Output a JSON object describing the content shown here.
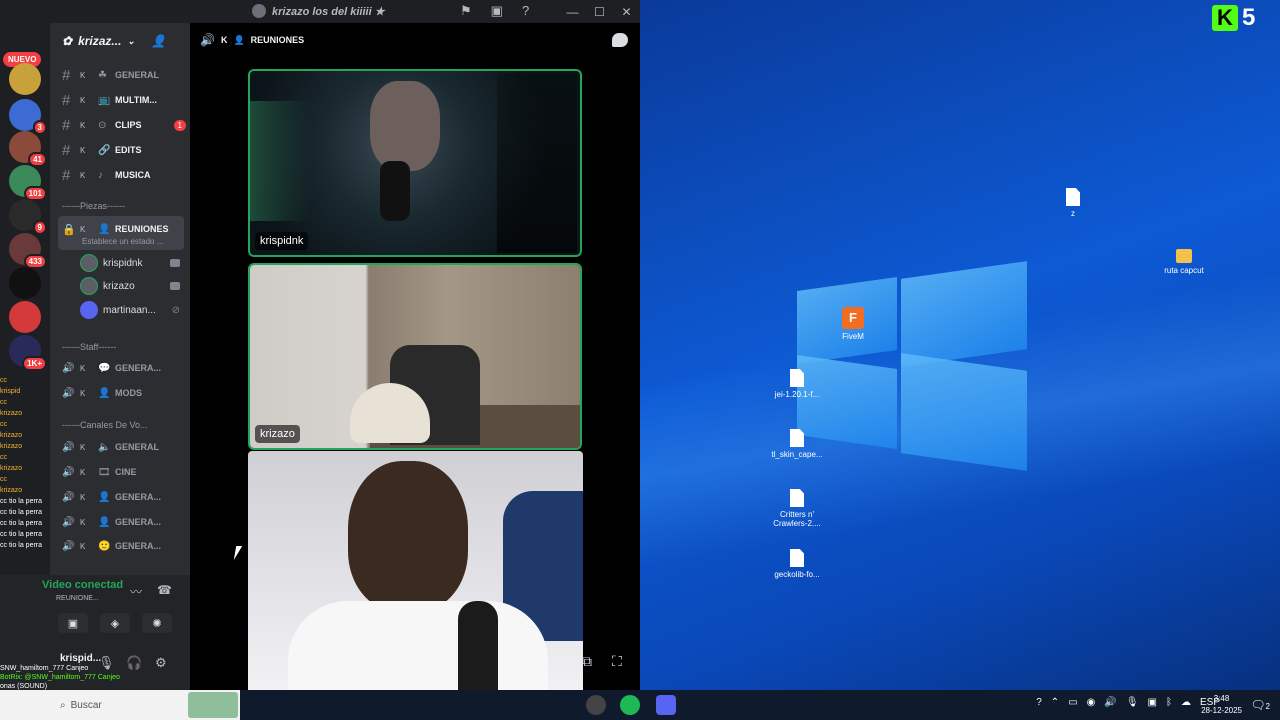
{
  "window": {
    "title": "krizazo los del kiiiii ★"
  },
  "servers": {
    "new_badge": "NUEVO",
    "items": [
      {
        "badge": ""
      },
      {
        "badge": "3"
      },
      {
        "badge": "41"
      },
      {
        "badge": "101"
      },
      {
        "badge": "9"
      },
      {
        "badge": "433"
      },
      {
        "badge": ""
      },
      {
        "badge": ""
      },
      {
        "badge": "1K+"
      }
    ]
  },
  "server": {
    "name": "krizaz..."
  },
  "text_channels": [
    {
      "k": "K",
      "name": "GENERAL",
      "emoji": "☘",
      "badge": ""
    },
    {
      "k": "K",
      "name": "MULTIM...",
      "emoji": "📺",
      "badge": ""
    },
    {
      "k": "K",
      "name": "CLIPS",
      "emoji": "⊙",
      "badge": "1"
    },
    {
      "k": "K",
      "name": "EDITS",
      "emoji": "🔗",
      "badge": ""
    },
    {
      "k": "K",
      "name": "MUSICA",
      "emoji": "♪",
      "badge": ""
    }
  ],
  "categories": {
    "piezas": "------Piezas------",
    "staff": "------Staff------",
    "canales_voz": "------Canales De Vo..."
  },
  "active_channel": {
    "k": "K",
    "name": "REUNIONES",
    "status": "Establece un estado ..."
  },
  "voice_users": [
    {
      "name": "krispidnk"
    },
    {
      "name": "krizazo"
    },
    {
      "name": "martinaan..."
    }
  ],
  "staff_channels": [
    {
      "k": "K",
      "name": "GENERA..."
    },
    {
      "k": "K",
      "name": "MODS"
    }
  ],
  "voice_channels": [
    {
      "k": "K",
      "name": "GENERAL"
    },
    {
      "k": "K",
      "name": "CINE"
    },
    {
      "k": "K",
      "name": "GENERA..."
    },
    {
      "k": "K",
      "name": "GENERA..."
    },
    {
      "k": "K",
      "name": "GENERA..."
    }
  ],
  "voice_panel": {
    "status": "Video conectad",
    "channel": "REUNIONE...",
    "user": "krispid..."
  },
  "stage": {
    "k": "K",
    "channel": "REUNIONES",
    "tiles": [
      {
        "name": "krispidnk"
      },
      {
        "name": "krizazo"
      }
    ]
  },
  "chat_overlay": {
    "lines": [
      "cc",
      "krispid",
      "cc",
      "krizazo",
      "cc",
      "krizazo",
      "krizazo",
      "cc",
      "krizazo",
      "cc",
      "krizazo"
    ],
    "lines2": [
      "cc tio la perra",
      "cc tio la perra",
      "cc tio la perra",
      "cc tio la perra",
      "cc tio la perra"
    ],
    "bottom1": "SNW_hamiltom_777 Canjeo",
    "bottom2": "BotRix: @SNW_hamiltom_777 Canjeo",
    "bottom3": "onas (SOUND)"
  },
  "desktop": {
    "icons": [
      {
        "label": "z"
      },
      {
        "label": "ruta capcut"
      },
      {
        "label": "FiveM"
      },
      {
        "label": "jei-1.20.1-f..."
      },
      {
        "label": "tl_skin_cape..."
      },
      {
        "label": "Critters n' Crawlers-2...."
      },
      {
        "label": "geckolib-fo..."
      }
    ],
    "kick_number": "5"
  },
  "taskbar": {
    "search": "Buscar",
    "lang": "ESP",
    "time": "3:48",
    "date": "28-12-2025",
    "notif": "2"
  }
}
